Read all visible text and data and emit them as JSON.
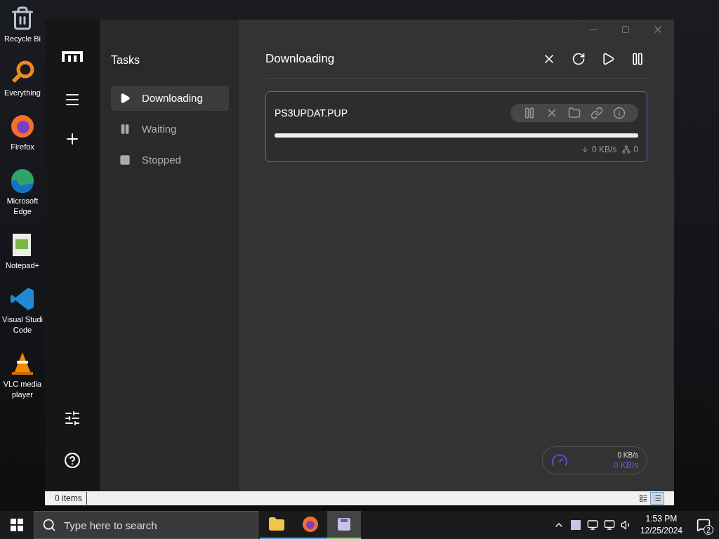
{
  "desktop_icons": [
    {
      "kind": "recycle",
      "lines": [
        "Recycle Bi"
      ]
    },
    {
      "kind": "search",
      "lines": [
        "Everything"
      ]
    },
    {
      "kind": "firefox",
      "lines": [
        "Firefox"
      ]
    },
    {
      "kind": "edge",
      "lines": [
        "Microsoft",
        "Edge"
      ]
    },
    {
      "kind": "notepad",
      "lines": [
        "Notepad+"
      ]
    },
    {
      "kind": "vscode",
      "lines": [
        "Visual Studi",
        "Code"
      ]
    },
    {
      "kind": "vlc",
      "lines": [
        "VLC media",
        "player"
      ]
    }
  ],
  "tasks_panel": {
    "title": "Tasks",
    "items": [
      {
        "kind": "play",
        "label": "Downloading",
        "selected": true
      },
      {
        "kind": "pause",
        "label": "Waiting",
        "selected": false
      },
      {
        "kind": "stop",
        "label": "Stopped",
        "selected": false
      }
    ]
  },
  "main": {
    "title": "Downloading",
    "tasks": [
      {
        "name": "PS3UPDAT.PUP",
        "selected": true,
        "level": 1,
        "speed": "0 KB/s",
        "connections": "0"
      }
    ]
  },
  "speed_widget": {
    "upload": "0 KB/s",
    "download": "0 KB/s"
  },
  "status_bar": {
    "count": "0 items",
    "views": [
      {
        "selected": false
      },
      {
        "selected": true
      }
    ]
  },
  "taskbar": {
    "search": {
      "placeholder": "Type here to search"
    },
    "apps": [
      {
        "kind": "folder",
        "selected": false
      },
      {
        "kind": "firefox",
        "selected": false
      },
      {
        "kind": "app",
        "selected": true
      }
    ],
    "time": "1:53 PM",
    "date": "12/25/2024",
    "notifications": "2"
  }
}
